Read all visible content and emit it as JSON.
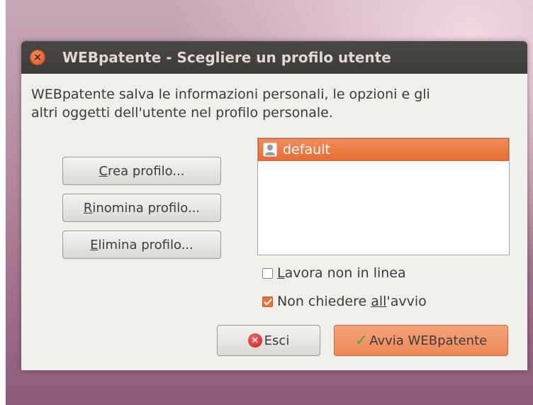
{
  "window": {
    "title": "WEBpatente - Scegliere un profilo utente",
    "close_icon": "close-icon"
  },
  "description": {
    "line1": "WEBpatente salva le informazioni personali, le opzioni e gli",
    "line2": "altri oggetti dell'utente nel profilo personale."
  },
  "actions": {
    "create": {
      "mnemonic": "C",
      "rest": "rea profilo..."
    },
    "rename": {
      "mnemonic": "R",
      "rest": "inomina profilo..."
    },
    "delete": {
      "mnemonic": "E",
      "rest": "limina profilo..."
    }
  },
  "profiles": {
    "items": [
      {
        "label": "default",
        "icon": "user-icon",
        "selected": true
      }
    ]
  },
  "options": {
    "offline": {
      "mnemonic": "L",
      "rest": "avora non in linea",
      "checked": false
    },
    "no_ask": {
      "before": "Non chiedere ",
      "mnemonic": "a",
      "middle": "ll",
      "after": "'avvio",
      "checked": true
    }
  },
  "footer": {
    "exit_label": "Esci",
    "start_label": "Avvia WEBpatente"
  },
  "colors": {
    "accent": "#e8743c",
    "titlebar": "#3c3b37",
    "window_bg": "#efefec"
  }
}
